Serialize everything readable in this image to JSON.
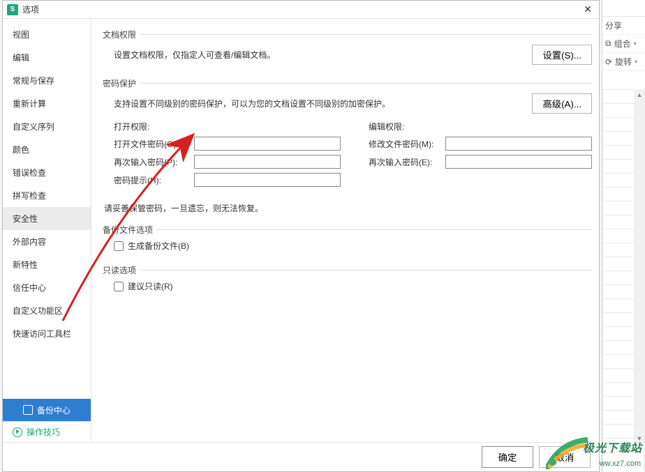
{
  "dialog": {
    "title": "选项",
    "close_glyph": "✕"
  },
  "sidebar": {
    "items": [
      {
        "label": "视图",
        "active": false
      },
      {
        "label": "编辑",
        "active": false
      },
      {
        "label": "常规与保存",
        "active": false
      },
      {
        "label": "重新计算",
        "active": false
      },
      {
        "label": "自定义序列",
        "active": false
      },
      {
        "label": "颜色",
        "active": false
      },
      {
        "label": "错误检查",
        "active": false
      },
      {
        "label": "拼写检查",
        "active": false
      },
      {
        "label": "安全性",
        "active": true
      },
      {
        "label": "外部内容",
        "active": false
      },
      {
        "label": "新特性",
        "active": false
      },
      {
        "label": "信任中心",
        "active": false
      },
      {
        "label": "自定义功能区",
        "active": false
      },
      {
        "label": "快速访问工具栏",
        "active": false
      }
    ],
    "backup_center": "备份中心",
    "tips": "操作技巧"
  },
  "security": {
    "doc_perm": {
      "legend": "文档权限",
      "note": "设置文档权限，仅指定人可查看/编辑文档。",
      "button": "设置(S)..."
    },
    "password": {
      "legend": "密码保护",
      "note": "支持设置不同级别的密码保护，可以为您的文档设置不同级别的加密保护。",
      "button": "高级(A)...",
      "open_header": "打开权限:",
      "edit_header": "编辑权限:",
      "open_label": "打开文件密码(O):",
      "open_confirm": "再次输入密码(P):",
      "hint_label": "密码提示(H):",
      "modify_label": "修改文件密码(M):",
      "modify_confirm": "再次输入密码(E):"
    },
    "warning": "请妥善保管密码，一旦遗忘，则无法恢复。",
    "backup": {
      "legend": "备份文件选项",
      "checkbox": "生成备份文件(B)"
    },
    "readonly": {
      "legend": "只读选项",
      "checkbox": "建议只读(R)"
    }
  },
  "footer": {
    "ok": "确定",
    "cancel": "取消"
  },
  "bg": {
    "share": "分享",
    "group": "组合",
    "rotate": "旋转"
  },
  "watermark": {
    "name": "极光下载站",
    "url": "ww.xz7.com"
  }
}
